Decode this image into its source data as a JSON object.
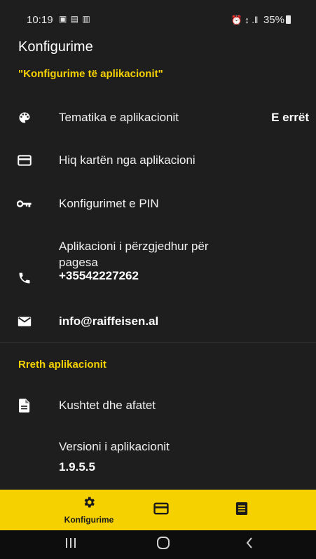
{
  "status_bar": {
    "time": "10:19",
    "left_icons": "▣ ▤ ▥",
    "right_icons": "⏰ ↕ .‖",
    "battery": "35%"
  },
  "app_bar": {
    "title": "Konfigurime"
  },
  "settings_section": {
    "header": "\"Konfigurime të aplikacionit\"",
    "theme": {
      "label": "Tematika e aplikacionit",
      "value": "E errët",
      "icon": "palette-icon"
    },
    "remove_card": {
      "label": "Hiq kartën nga aplikacioni",
      "icon": "card-icon"
    },
    "pin": {
      "label": "Konfigurimet e PIN",
      "icon": "key-icon"
    },
    "phone": {
      "label_line1": "Aplikacioni i përzgjedhur për",
      "label_line2": "pagesa",
      "number": "+35542227262",
      "icon": "phone-icon"
    },
    "email": {
      "value": "info@raiffeisen.al",
      "icon": "mail-icon"
    }
  },
  "about_section": {
    "header": "Rreth aplikacionit",
    "terms": {
      "label": "Kushtet dhe afatet",
      "icon": "document-icon"
    },
    "version": {
      "label": "Versioni i aplikacionit",
      "value": "1.9.5.5"
    }
  },
  "bottom_nav": {
    "items": [
      {
        "label": "Konfigurime",
        "icon": "gear-icon",
        "active": true
      },
      {
        "label": "",
        "icon": "card-icon"
      },
      {
        "label": "",
        "icon": "list-icon"
      }
    ]
  },
  "colors": {
    "background": "#1e1e1e",
    "accent": "#f5d100",
    "text": "#ffffff"
  }
}
